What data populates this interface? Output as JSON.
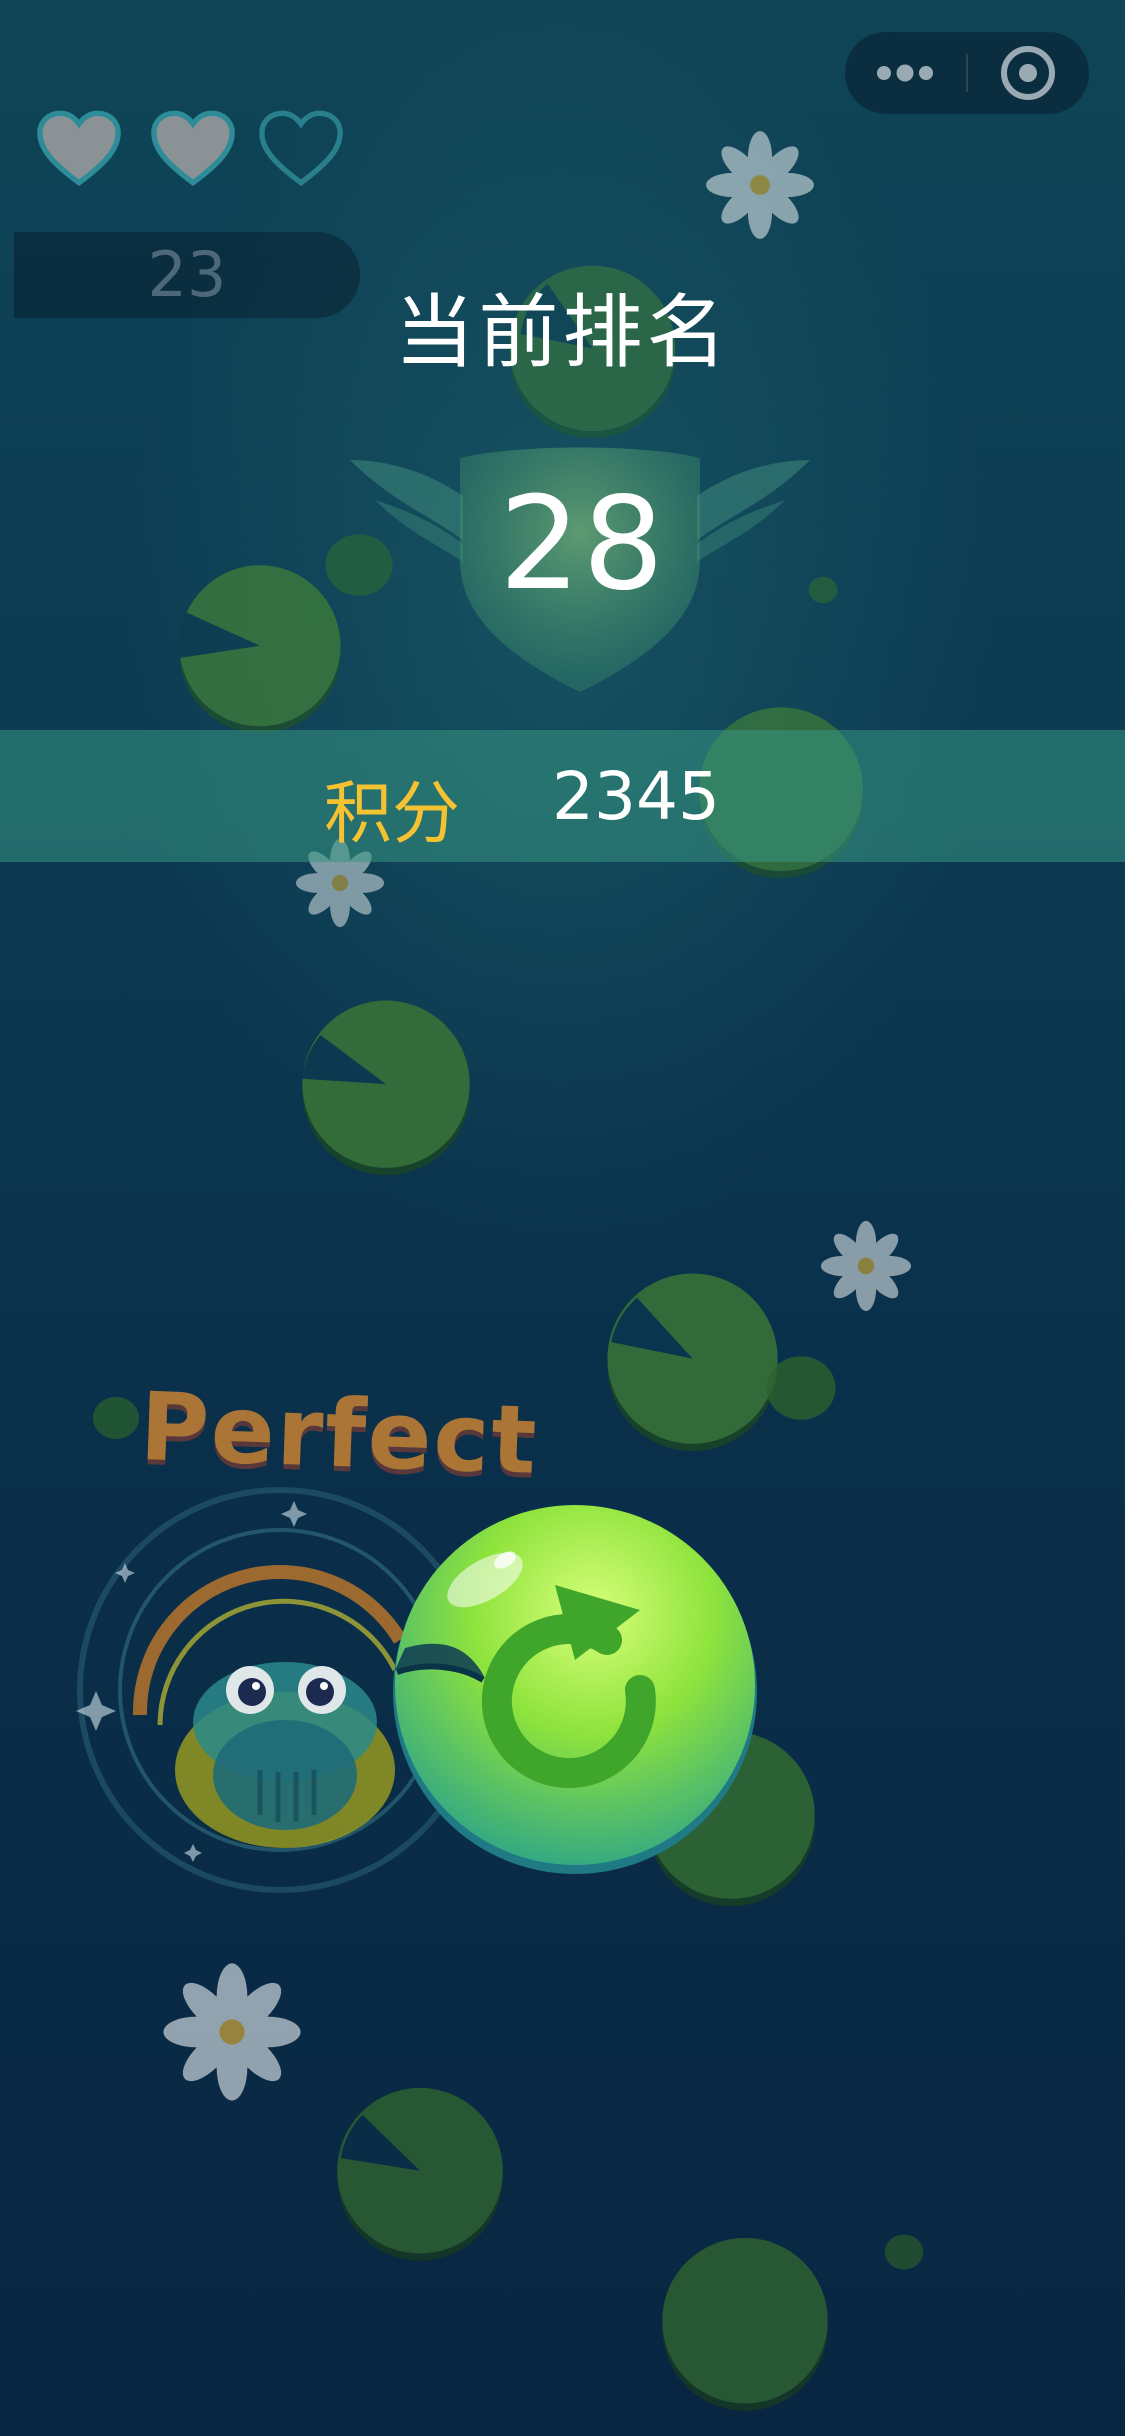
{
  "hud": {
    "hearts": [
      {
        "state": "full"
      },
      {
        "state": "full"
      },
      {
        "state": "empty"
      }
    ],
    "level": "23"
  },
  "capsule": {
    "more_icon": "more-dots-icon",
    "close_icon": "target-circle-icon"
  },
  "result": {
    "title": "当前排名",
    "rank": "28",
    "score_label": "积分",
    "score_value": "2345"
  },
  "feedback": {
    "perfect_text": "Perfect"
  },
  "actions": {
    "restart_icon": "restart-arrow-icon"
  },
  "colors": {
    "background_top": "#0f4557",
    "background_bottom": "#082642",
    "accent_gold": "#f5c232",
    "score_banner": "#379682",
    "restart_green": "#8ee33c",
    "lily_pad": "#3f8a3a"
  }
}
